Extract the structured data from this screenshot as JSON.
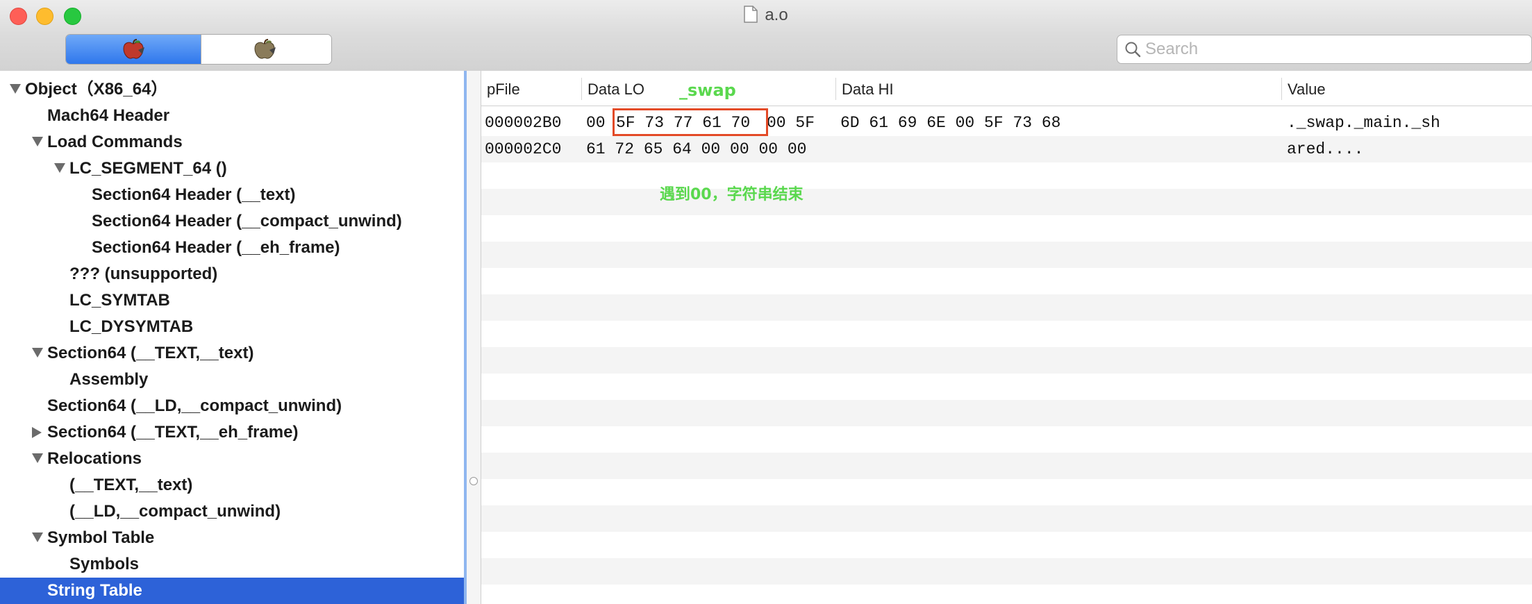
{
  "window": {
    "title": "a.o",
    "colors": {
      "close": "#fe5f57",
      "minimize": "#febc2e",
      "maximize": "#28c840"
    }
  },
  "toolbar": {
    "segments": [
      {
        "icon": "apple-red-icon"
      },
      {
        "icon": "apple-gray-icon"
      }
    ],
    "search": {
      "placeholder": "Search",
      "value": ""
    }
  },
  "sidebar": {
    "selection_color": "#2d62d8",
    "items": [
      {
        "label": "Object（X86_64）",
        "level": 0,
        "expand": "down"
      },
      {
        "label": "Mach64 Header",
        "level": 1,
        "expand": "none"
      },
      {
        "label": "Load Commands",
        "level": 1,
        "expand": "down"
      },
      {
        "label": "LC_SEGMENT_64 ()",
        "level": 2,
        "expand": "down"
      },
      {
        "label": "Section64 Header (__text)",
        "level": 3,
        "expand": "none"
      },
      {
        "label": "Section64 Header (__compact_unwind)",
        "level": 3,
        "expand": "none"
      },
      {
        "label": "Section64 Header (__eh_frame)",
        "level": 3,
        "expand": "none"
      },
      {
        "label": "??? (unsupported)",
        "level": 2,
        "expand": "none"
      },
      {
        "label": "LC_SYMTAB",
        "level": 2,
        "expand": "none"
      },
      {
        "label": "LC_DYSYMTAB",
        "level": 2,
        "expand": "none"
      },
      {
        "label": "Section64 (__TEXT,__text)",
        "level": 1,
        "expand": "down"
      },
      {
        "label": "Assembly",
        "level": 2,
        "expand": "none"
      },
      {
        "label": "Section64 (__LD,__compact_unwind)",
        "level": 1,
        "expand": "none"
      },
      {
        "label": "Section64 (__TEXT,__eh_frame)",
        "level": 1,
        "expand": "right"
      },
      {
        "label": "Relocations",
        "level": 1,
        "expand": "down"
      },
      {
        "label": "(__TEXT,__text)",
        "level": 2,
        "expand": "none"
      },
      {
        "label": "(__LD,__compact_unwind)",
        "level": 2,
        "expand": "none"
      },
      {
        "label": "Symbol Table",
        "level": 1,
        "expand": "down"
      },
      {
        "label": "Symbols",
        "level": 2,
        "expand": "none"
      },
      {
        "label": "String Table",
        "level": 1,
        "expand": "none",
        "selected": true
      }
    ]
  },
  "table": {
    "columns": [
      "pFile",
      "Data LO",
      "Data HI",
      "Value"
    ],
    "rows": [
      {
        "pfile": "000002B0",
        "lo_pre": "00",
        "lo_hl": "5F 73 77 61 70",
        "lo_post": "00 5F",
        "hi": "6D 61 69 6E 00 5F 73 68",
        "value": "._swap._main._sh"
      },
      {
        "pfile": "000002C0",
        "lo_pre": "61 72 65 64 00 00 00 00",
        "lo_hl": "",
        "lo_post": "",
        "hi": "",
        "value": "ared...."
      }
    ]
  },
  "annotations": {
    "swap": "_swap",
    "note": "遇到00，字符串结束",
    "color": "#5ad84e",
    "box_color": "#e34a27"
  }
}
